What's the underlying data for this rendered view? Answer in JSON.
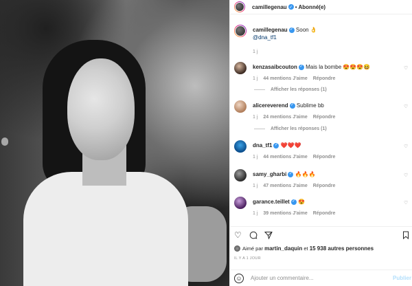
{
  "header": {
    "username": "camillegenau",
    "separator": "•",
    "follow_label": "Abonné(e)"
  },
  "caption": {
    "username": "camillegenau",
    "text": "Soon",
    "emoji": "👌",
    "mention": "@dna_tf1",
    "time": "1 j"
  },
  "comments": [
    {
      "username": "kenzasaibcouton",
      "text": "Mais la bombe 😍😍😍😆",
      "time": "1 j",
      "likes": "44 mentions J'aime",
      "reply": "Répondre",
      "replies_link": "Afficher les réponses (1)"
    },
    {
      "username": "alicereverend",
      "text": "Sublime bb",
      "time": "1 j",
      "likes": "24 mentions J'aime",
      "reply": "Répondre",
      "replies_link": "Afficher les réponses (1)"
    },
    {
      "username": "dna_tf1",
      "text": "❤️❤️❤️",
      "time": "1 j",
      "likes": "44 mentions J'aime",
      "reply": "Répondre"
    },
    {
      "username": "samy_gharbi",
      "text": "🔥🔥🔥",
      "time": "1 j",
      "likes": "47 mentions J'aime",
      "reply": "Répondre"
    },
    {
      "username": "garance.teillet",
      "text": "😍",
      "time": "1 j",
      "likes": "39 mentions J'aime",
      "reply": "Répondre"
    }
  ],
  "likes": {
    "prefix": "Aimé par",
    "user": "martin_daquin",
    "suffix": "et",
    "count_text": "15 938 autres personnes"
  },
  "post_time": "IL Y A 1 JOUR",
  "composer": {
    "placeholder": "Ajouter un commentaire...",
    "publish": "Publier"
  },
  "icons": {
    "header_more": "more-icon",
    "like": "heart-icon",
    "comment": "comment-icon",
    "share": "share-icon",
    "save": "bookmark-icon",
    "emoji": "emoji-icon"
  }
}
